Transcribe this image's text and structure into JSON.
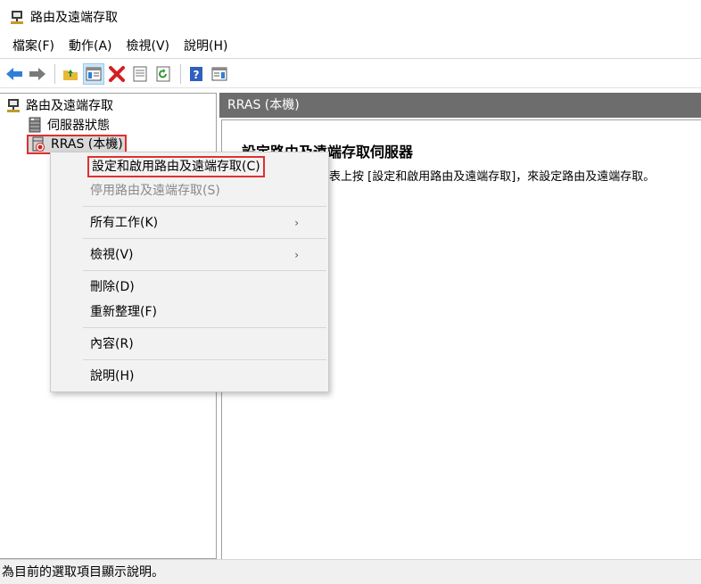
{
  "window": {
    "title": "路由及遠端存取"
  },
  "menubar": {
    "items": [
      "檔案(F)",
      "動作(A)",
      "檢視(V)",
      "說明(H)"
    ]
  },
  "toolbar": {
    "buttons": [
      "back-arrow-icon",
      "forward-arrow-icon",
      "up-folder-icon",
      "show-hide-tree-icon",
      "delete-icon",
      "properties-icon",
      "refresh-icon",
      "help-icon",
      "action-pane-icon"
    ],
    "active": "show-hide-tree-icon"
  },
  "tree": {
    "root": "路由及遠端存取",
    "server_status": "伺服器狀態",
    "rras": "RRAS (本機)"
  },
  "right_pane": {
    "header": "RRAS (本機)",
    "heading": "設定路由及遠端存取伺服器",
    "description": "表上按 [設定和啟用路由及遠端存取]，來設定路由及遠端存取。"
  },
  "context_menu": {
    "configure": "設定和啟用路由及遠端存取(C)",
    "disable": "停用路由及遠端存取(S)",
    "all_tasks": "所有工作(K)",
    "view": "檢視(V)",
    "delete": "刪除(D)",
    "refresh": "重新整理(F)",
    "properties": "內容(R)",
    "help": "說明(H)",
    "submenu_arrow": "›"
  },
  "statusbar": {
    "text": "為目前的選取項目顯示說明。"
  },
  "colors": {
    "highlight": "#e03030",
    "header_bg": "#6d6d6d",
    "menu_bg": "#f2f2f2"
  }
}
